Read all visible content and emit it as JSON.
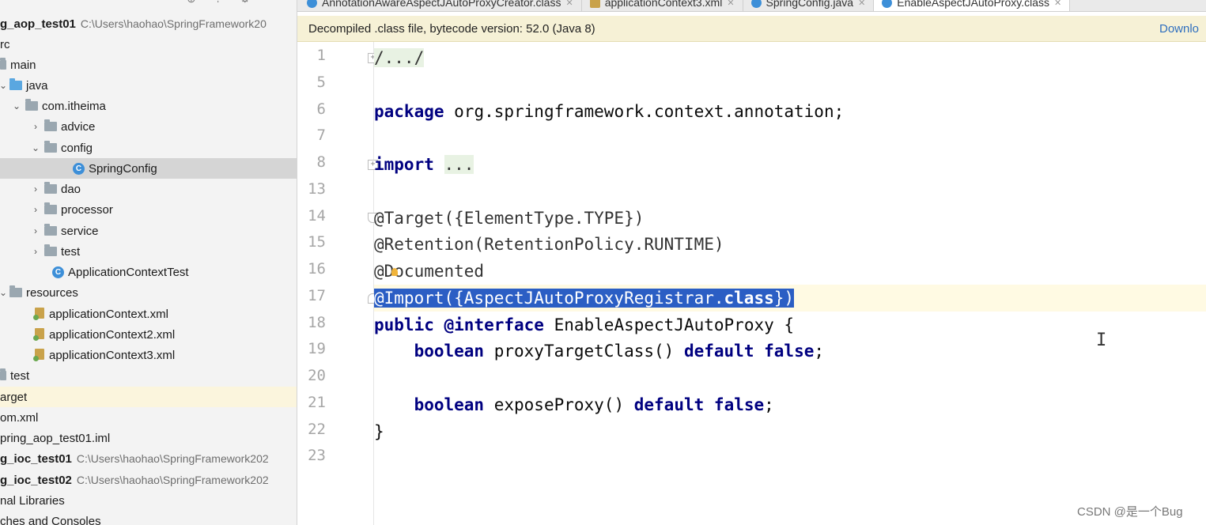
{
  "tree": {
    "toolbar_icons": [
      "target-icon",
      "collapse-icon",
      "gear-icon",
      "minimize-icon"
    ],
    "items": [
      {
        "label": "g_aop_test01",
        "path": "C:\\Users\\haohao\\SpringFramework20",
        "kind": "module"
      },
      {
        "label": "rc",
        "kind": "folder"
      },
      {
        "label": "main",
        "kind": "folder"
      },
      {
        "label": "java",
        "kind": "folder"
      },
      {
        "label": "com.itheima",
        "kind": "package"
      },
      {
        "label": "advice",
        "kind": "package"
      },
      {
        "label": "config",
        "kind": "package"
      },
      {
        "label": "SpringConfig",
        "kind": "class"
      },
      {
        "label": "dao",
        "kind": "package"
      },
      {
        "label": "processor",
        "kind": "package"
      },
      {
        "label": "service",
        "kind": "package"
      },
      {
        "label": "test",
        "kind": "package"
      },
      {
        "label": "ApplicationContextTest",
        "kind": "class"
      },
      {
        "label": "resources",
        "kind": "folder"
      },
      {
        "label": "applicationContext.xml",
        "kind": "xml"
      },
      {
        "label": "applicationContext2.xml",
        "kind": "xml"
      },
      {
        "label": "applicationContext3.xml",
        "kind": "xml"
      },
      {
        "label": "test",
        "kind": "folder"
      },
      {
        "label": "arget",
        "kind": "folder"
      },
      {
        "label": "om.xml",
        "kind": "file"
      },
      {
        "label": "pring_aop_test01.iml",
        "kind": "file"
      },
      {
        "label": "g_ioc_test01",
        "path": "C:\\Users\\haohao\\SpringFramework202",
        "kind": "module"
      },
      {
        "label": "g_ioc_test02",
        "path": "C:\\Users\\haohao\\SpringFramework202",
        "kind": "module"
      },
      {
        "label": "nal Libraries",
        "kind": "file"
      },
      {
        "label": "ches and Consoles",
        "kind": "file"
      }
    ]
  },
  "tabs": [
    {
      "label": "AnnotationAwareAspectJAutoProxyCreator.class",
      "icon": "class-icon"
    },
    {
      "label": "applicationContext3.xml",
      "icon": "xml-icon"
    },
    {
      "label": "SpringConfig.java",
      "icon": "class-icon"
    },
    {
      "label": "EnableAspectJAutoProxy.class",
      "icon": "class-icon",
      "active": true
    }
  ],
  "banner": {
    "message": "Decompiled .class file, bytecode version: 52.0 (Java 8)",
    "action": "Downlo"
  },
  "code": {
    "line_numbers": [
      "1",
      "5",
      "6",
      "7",
      "8",
      "13",
      "14",
      "15",
      "16",
      "17",
      "18",
      "19",
      "20",
      "21",
      "22",
      "23"
    ],
    "l1": "/.../",
    "l6_kw": "package",
    "l6_rest": " org.springframework.context.annotation;",
    "l8_kw": "import",
    "l8_fold": "...",
    "l14": "@Target({ElementType.TYPE})",
    "l15": "@Retention(RetentionPolicy.RUNTIME)",
    "l16": "@Documented",
    "l17_a": "@Import({AspectJAutoProxyRegistrar.",
    "l17_kw": "class",
    "l17_b": "})",
    "l18_kw1": "public",
    "l18_kw2": "@interface",
    "l18_rest": " EnableAspectJAutoProxy {",
    "l19_kw1": "boolean",
    "l19_mid": " proxyTargetClass() ",
    "l19_kw2": "default",
    "l19_kw3": "false",
    "l19_end": ";",
    "l21_kw1": "boolean",
    "l21_mid": " exposeProxy() ",
    "l21_kw2": "default",
    "l21_kw3": "false",
    "l21_end": ";",
    "l22": "}"
  },
  "watermark": "CSDN @是一个Bug"
}
